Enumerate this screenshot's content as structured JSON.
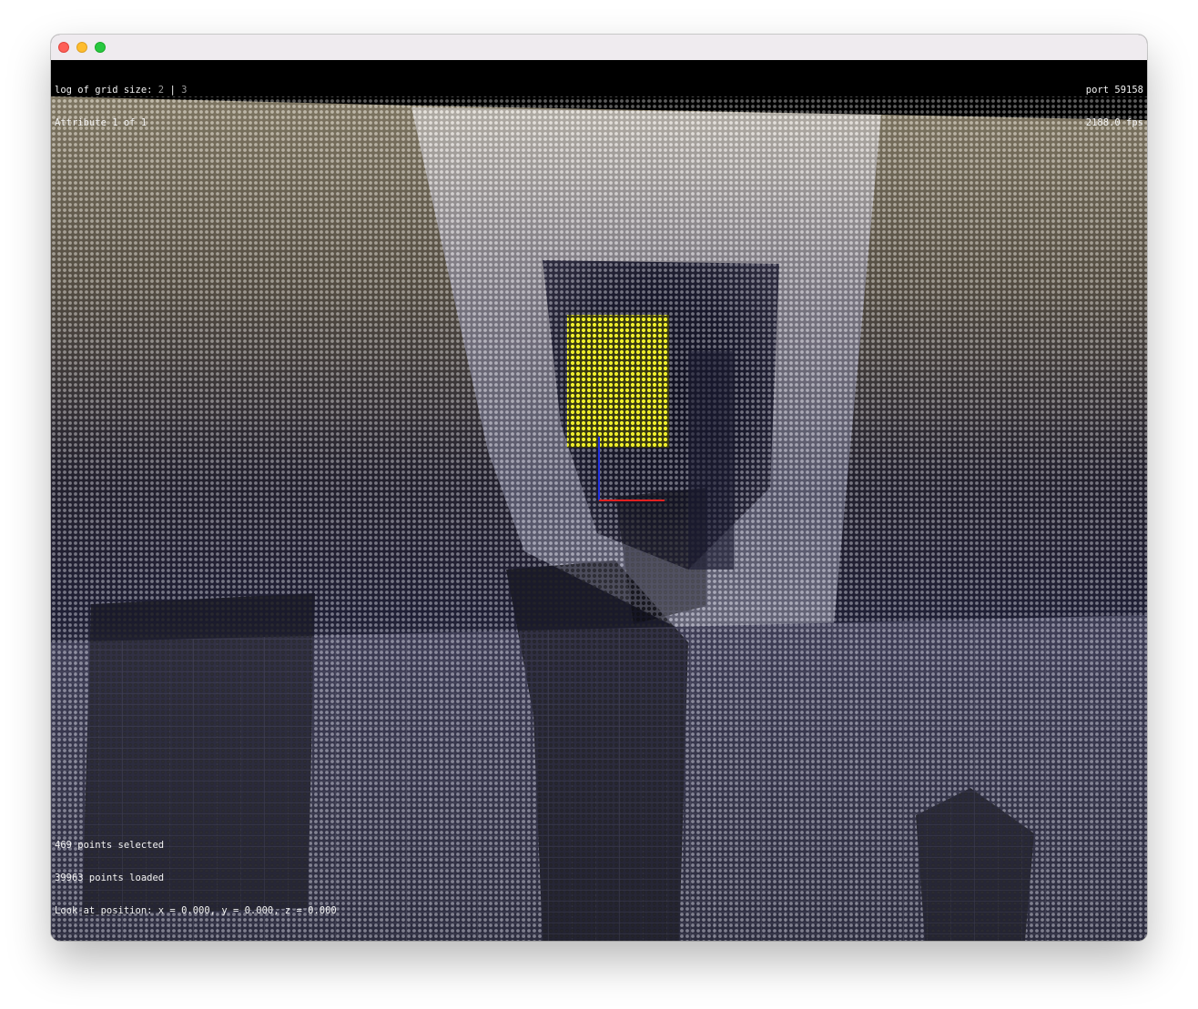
{
  "hud": {
    "grid_size_label": "log of grid size:",
    "grid_size_current": "2",
    "grid_size_separator": "|",
    "grid_size_next": "3",
    "attribute": "Attribute 1 of 1",
    "port": "port 59158",
    "fps": "2188.0 fps",
    "points_selected": "469 points selected",
    "points_loaded": "39963 points loaded",
    "look_at": "Look-at position: x = 0.000, y = 0.000, z = 0.000"
  },
  "colors": {
    "selection": "#e6e62a",
    "axis_x": "#e02020",
    "axis_y": "#2030e0",
    "background": "#000000"
  },
  "icons": [
    "close-icon",
    "minimize-icon",
    "maximize-icon"
  ]
}
